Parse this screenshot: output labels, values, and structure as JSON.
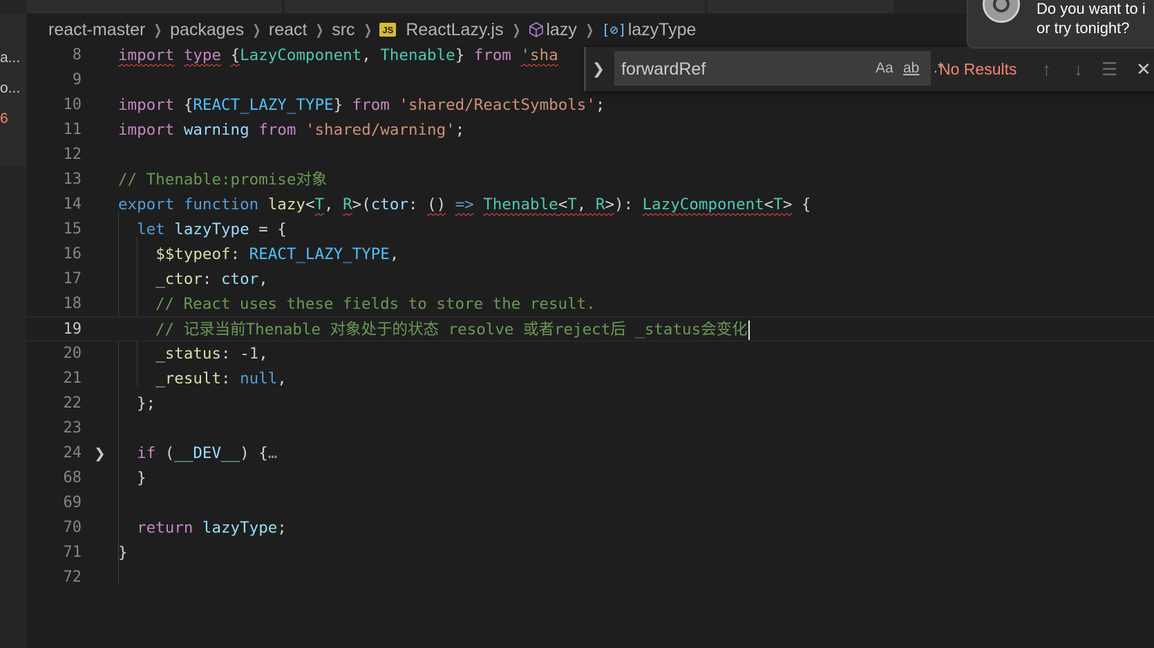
{
  "breadcrumb": {
    "items": [
      "react-master",
      "packages",
      "react",
      "src",
      "ReactLazy.js",
      "lazy",
      "lazyType"
    ],
    "file_icon": "JS"
  },
  "explorer_fragments": [
    "a...",
    "o...",
    "6"
  ],
  "find_widget": {
    "query": "forwardRef",
    "match_case_label": "Aa",
    "whole_word_label": "ab",
    "regex_label": ".*",
    "status": "No Results"
  },
  "notification": {
    "line1": "Do you want to i",
    "line2": "or try tonight?"
  },
  "editor": {
    "current_line": "19",
    "line_numbers": [
      "8",
      "9",
      "10",
      "11",
      "12",
      "13",
      "14",
      "15",
      "16",
      "17",
      "18",
      "19",
      "20",
      "21",
      "22",
      "23",
      "24",
      "68",
      "69",
      "70",
      "71",
      "72"
    ],
    "lines": [
      "import type {LazyComponent, Thenable} from 'sha",
      "",
      "import {REACT_LAZY_TYPE} from 'shared/ReactSymbols';",
      "import warning from 'shared/warning';",
      "",
      "// Thenable:promise对象",
      "export function lazy<T, R>(ctor: () => Thenable<T, R>): LazyComponent<T> {",
      "let lazyType = {",
      "$$typeof: REACT_LAZY_TYPE,",
      "_ctor: ctor,",
      "// React uses these fields to store the result.",
      "// 记录当前Thenable 对象处于的状态 resolve 或者reject后 _status会变化",
      "_status: -1,",
      "_result: null,",
      "};",
      "",
      "if (__DEV__) {…",
      "}",
      "",
      "return lazyType;",
      "}",
      ""
    ]
  },
  "colors": {
    "background": "#1e1e1e",
    "keyword": "#c586c0",
    "string": "#ce9178",
    "comment": "#6a9955",
    "type": "#4ec9b0",
    "variable": "#9cdcfe",
    "no_results": "#f48771"
  }
}
